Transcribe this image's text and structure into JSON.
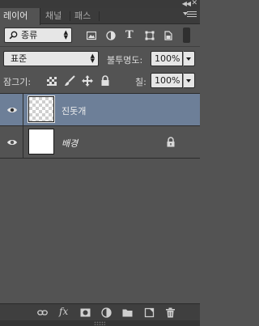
{
  "tabs": [
    {
      "label": "레이어",
      "active": true
    },
    {
      "label": "채널",
      "active": false
    },
    {
      "label": "패스",
      "active": false
    }
  ],
  "filter": {
    "kind_label": "종류",
    "icons": [
      "image-filter-icon",
      "adjustment-filter-icon",
      "type-filter-icon",
      "shape-filter-icon",
      "smart-object-filter-icon"
    ],
    "type_glyph": "T"
  },
  "blend": {
    "mode": "표준",
    "opacity_label": "불투명도:",
    "opacity_value": "100%"
  },
  "lock": {
    "label": "잠그기:",
    "fill_label": "칠:",
    "fill_value": "100%"
  },
  "layers": [
    {
      "name": "진돗개",
      "selected": true,
      "visible": true,
      "locked": false
    },
    {
      "name": "배경",
      "selected": false,
      "visible": true,
      "locked": true
    }
  ],
  "bottom_toolbar": {
    "fx_label": "fx"
  },
  "colors": {
    "panel_bg": "#535353",
    "selected_layer": "#6d7f98",
    "tab_bar": "#3b3b3b"
  }
}
